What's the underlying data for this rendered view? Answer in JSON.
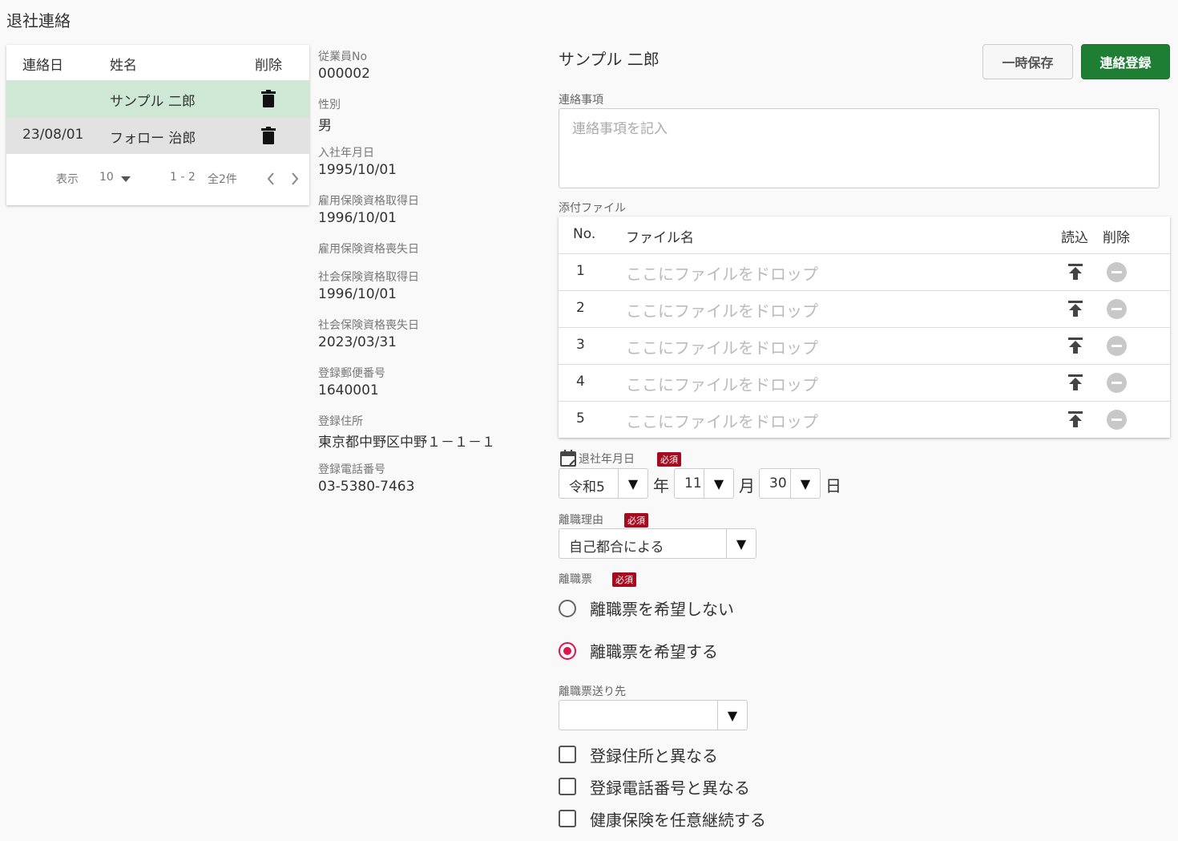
{
  "page": {
    "title": "退社連絡"
  },
  "list": {
    "headers": {
      "date": "連絡日",
      "name": "姓名",
      "delete": "削除"
    },
    "rows": [
      {
        "date": "",
        "name": "サンプル 二郎",
        "selected": true
      },
      {
        "date": "23/08/01",
        "name": "フォロー 治郎",
        "selected": false
      }
    ],
    "pager": {
      "show_label": "表示",
      "page_size": "10",
      "range": "1 - 2",
      "total": "全2件"
    }
  },
  "info": [
    {
      "label": "従業員No",
      "value": "000002"
    },
    {
      "label": "性別",
      "value": "男"
    },
    {
      "label": "入社年月日",
      "value": "1995/10/01"
    },
    {
      "label": "雇用保険資格取得日",
      "value": "1996/10/01"
    },
    {
      "label": "雇用保険資格喪失日",
      "value": ""
    },
    {
      "label": "社会保険資格取得日",
      "value": "1996/10/01"
    },
    {
      "label": "社会保険資格喪失日",
      "value": "2023/03/31"
    },
    {
      "label": "登録郵便番号",
      "value": "1640001"
    },
    {
      "label": "登録住所",
      "value": "東京都中野区中野１－１－１"
    },
    {
      "label": "登録電話番号",
      "value": "03-5380-7463"
    }
  ],
  "form": {
    "employee_name": "サンプル 二郎",
    "temp_save_label": "一時保存",
    "register_label": "連絡登録",
    "notes_label": "連絡事項",
    "notes_placeholder": "連絡事項を記入",
    "attach_label": "添付ファイル",
    "file_headers": {
      "no": "No.",
      "name": "ファイル名",
      "upload": "読込",
      "delete": "削除"
    },
    "files": [
      {
        "no": "1",
        "placeholder": "ここにファイルをドロップ"
      },
      {
        "no": "2",
        "placeholder": "ここにファイルをドロップ"
      },
      {
        "no": "3",
        "placeholder": "ここにファイルをドロップ"
      },
      {
        "no": "4",
        "placeholder": "ここにファイルをドロップ"
      },
      {
        "no": "5",
        "placeholder": "ここにファイルをドロップ"
      }
    ],
    "required_badge": "必須",
    "retire_date": {
      "label": "退社年月日",
      "era": "令和5",
      "year_unit": "年",
      "month": "11",
      "month_unit": "月",
      "day": "30",
      "day_unit": "日"
    },
    "reason": {
      "label": "離職理由",
      "value": "自己都合による"
    },
    "slip": {
      "label": "離職票",
      "options": [
        {
          "label": "離職票を希望しない",
          "selected": false
        },
        {
          "label": "離職票を希望する",
          "selected": true
        }
      ]
    },
    "slip_dest": {
      "label": "離職票送り先",
      "value": ""
    },
    "checkboxes": [
      {
        "label": "登録住所と異なる",
        "checked": false
      },
      {
        "label": "登録電話番号と異なる",
        "checked": false
      },
      {
        "label": "健康保険を任意継続する",
        "checked": false
      }
    ],
    "colors": {
      "selected_row": "#cfe8d5",
      "alt_row": "#e2e2e2",
      "primary": "#1e7e34",
      "accent": "#e0134a",
      "required": "#a50a1e"
    }
  }
}
